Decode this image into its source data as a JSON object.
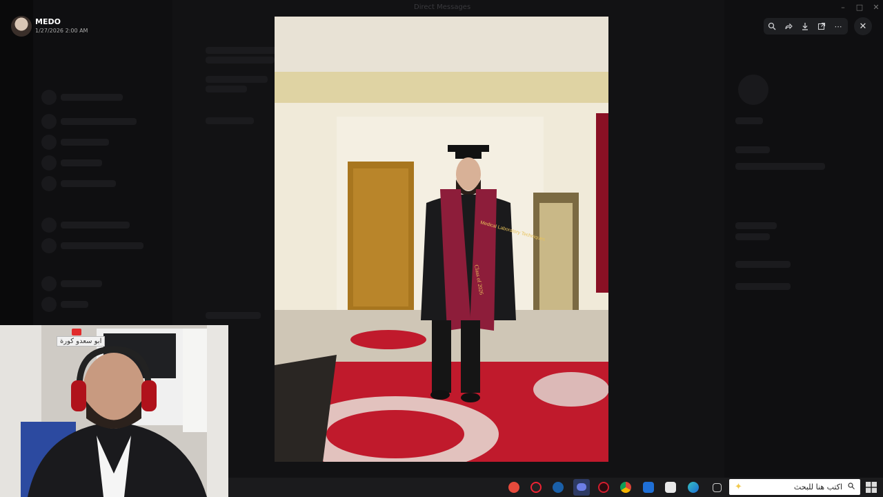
{
  "background": {
    "window_title": "Direct Messages"
  },
  "viewer": {
    "user_name": "MEDO",
    "timestamp": "1/27/2026 2:00 AM"
  },
  "toolbar": {
    "icons": [
      "zoom-icon",
      "forward-icon",
      "download-icon",
      "open-external-icon",
      "more-icon"
    ],
    "close_icon": "close-icon"
  },
  "photo": {
    "sash_left_text": "Medical Laboratory Techniques",
    "sash_right_text": "Class of 2026"
  },
  "webcam": {
    "sign_text": "ابو سعدو كورة"
  },
  "taskbar": {
    "search_placeholder": "اكتب هنا للبحث",
    "app_icons": [
      "recorder-icon",
      "app-icon",
      "steam-icon",
      "discord-icon",
      "app-red-icon",
      "chrome-icon",
      "mail-icon",
      "store-icon",
      "edge-icon",
      "task-view-icon"
    ]
  },
  "colors": {
    "taskbar_bg": "#1b1b1d",
    "toolbar_bg": "#1e1f22",
    "sash": "#8d1d3a",
    "carpet": "#c01a2c"
  }
}
